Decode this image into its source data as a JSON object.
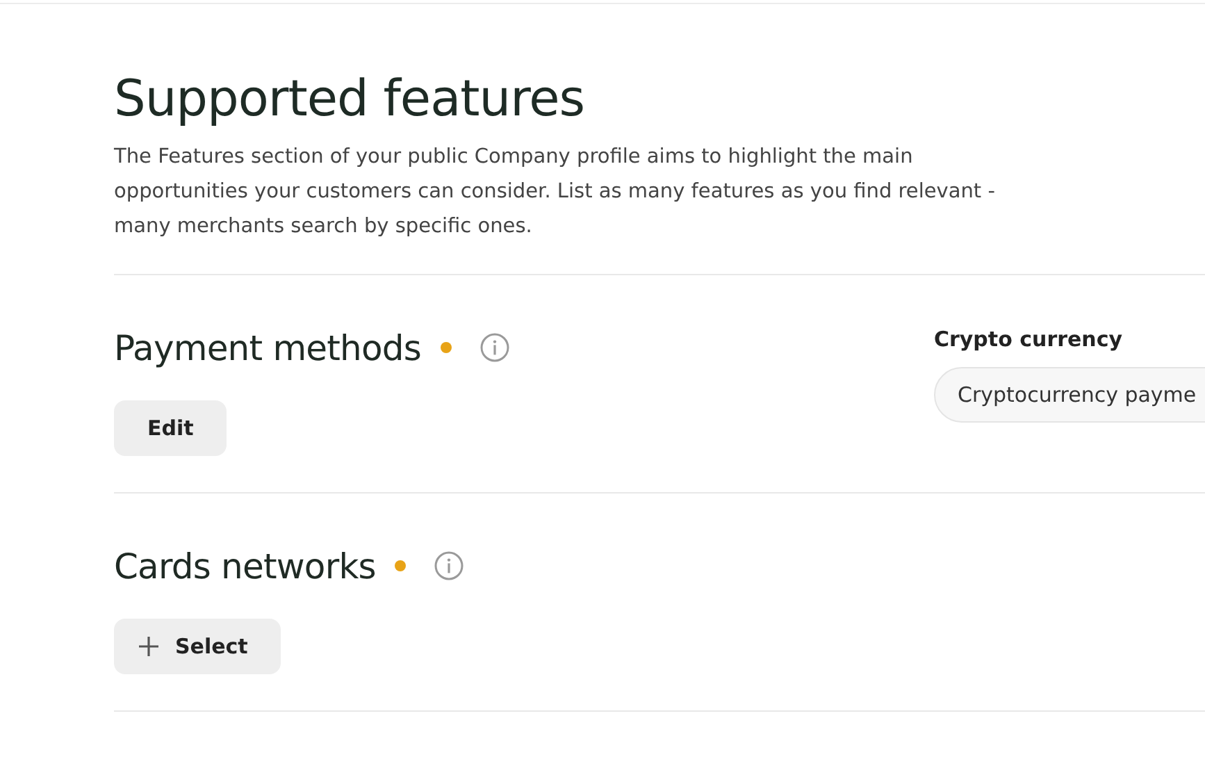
{
  "header": {
    "title": "Supported features",
    "description": "The Features section of your public Company profile aims to highlight the main opportunities your customers can consider. List as many features as you find relevant - many merchants search by specific ones."
  },
  "sections": [
    {
      "title": "Payment methods",
      "required": true,
      "button": {
        "kind": "edit",
        "label": "Edit"
      },
      "groups": [
        {
          "label": "Crypto currency",
          "chips": [
            "Cryptocurrency payme"
          ]
        }
      ]
    },
    {
      "title": "Cards networks",
      "required": true,
      "button": {
        "kind": "select",
        "label": "Select"
      }
    }
  ]
}
